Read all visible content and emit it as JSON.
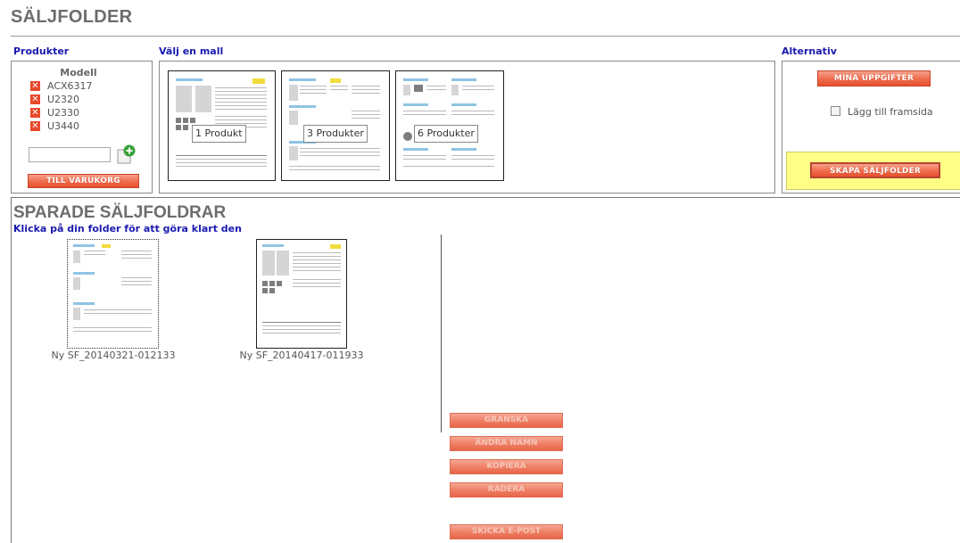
{
  "page": {
    "title": "SÄLJFOLDER"
  },
  "products": {
    "label": "Produkter",
    "column_header": "Modell",
    "items": [
      "ACX6317",
      "U2320",
      "U2330",
      "U3440"
    ],
    "remove_icon": "remove-icon",
    "input_value": "",
    "add_icon": "add-icon",
    "cart_button": "TILL VARUKORG"
  },
  "templates": {
    "label": "Välj en mall",
    "items": [
      {
        "label": "1 Produkt"
      },
      {
        "label": "3 Produkter"
      },
      {
        "label": "6 Produkter"
      }
    ]
  },
  "alternatives": {
    "label": "Alternativ",
    "my_info_button": "MINA UPPGIFTER",
    "add_cover_label": "Lägg till framsida",
    "add_cover_checked": false,
    "create_button": "SKAPA SÄLJFOLDER",
    "highlight_color": "#ffff88"
  },
  "saved": {
    "title": "SPARADE SÄLJFOLDRAR",
    "subtitle": "Klicka på din folder för att göra klart den",
    "folders": [
      {
        "name": "Ny SF_20140321-012133"
      },
      {
        "name": "Ny SF_20140417-011933"
      }
    ],
    "actions": {
      "review": "GRANSKA",
      "rename": "ÄNDRA NAMN",
      "copy": "KOPIERA",
      "delete": "RADERA",
      "send_email": "SKICKA E-POST"
    }
  },
  "colors": {
    "accent_button": "#ef6c4d",
    "section_label": "#1a1ab0",
    "title_gray": "#6d6d6d"
  }
}
